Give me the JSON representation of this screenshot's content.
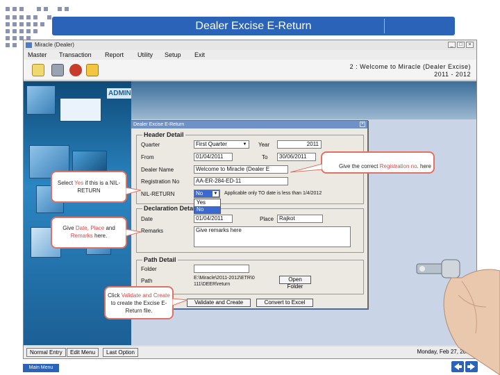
{
  "slide": {
    "title": "Dealer Excise E-Return",
    "main_menu_label": "Main Menu"
  },
  "window": {
    "title": "Miracle (Dealer)",
    "controls": [
      "_",
      "□",
      "×"
    ]
  },
  "menu": [
    "Master",
    "Transaction",
    "Report",
    "Utility",
    "Setup",
    "Exit"
  ],
  "welcome": {
    "line1": "2 : Welcome to Miracle (Dealer Excise)",
    "line2": "2011 - 2012"
  },
  "toolbar_icons": [
    "document-icon",
    "cart-icon",
    "money-bag-icon",
    "edit-icon"
  ],
  "left_pane": {
    "admin_text": "ADMIN"
  },
  "dialog": {
    "title": "Dealer Excise E-Return",
    "close": "×",
    "header_detail": {
      "title": "Header Detail",
      "quarter_label": "Quarter",
      "quarter_value": "First Quarter",
      "year_label": "Year",
      "year_value": "2011",
      "from_label": "From",
      "from_value": "01/04/2011",
      "to_label": "To",
      "to_value": "30/06/2011",
      "dealer_name_label": "Dealer Name",
      "dealer_name_value": "Welcome to Miracle (Dealer E",
      "reg_no_label": "Registration No",
      "reg_no_value": "AA-ER-284-ED-11",
      "nil_return_label": "NIL-RETURN",
      "nil_return_value": "No",
      "nil_return_note": "Applicable only TO date is less than 1/4/2012",
      "nil_return_options": [
        "Yes",
        "No"
      ]
    },
    "declaration_detail": {
      "title": "Declaration Detail",
      "date_label": "Date",
      "date_value": "01/04/2011",
      "place_label": "Place",
      "place_value": "Rajkot",
      "remarks_label": "Remarks",
      "remarks_value": "Give remarks here"
    },
    "path_detail": {
      "title": "Path Detail",
      "folder_label": "Folder",
      "folder_value": "",
      "path_label": "Path",
      "path_value_line1": "E:\\Miracle\\2011-2012\\ETR\\0",
      "path_value_line2": "111\\DEER\\return",
      "open_folder": "Open Folder"
    },
    "validate_button": "Validate and Create",
    "convert_button": "Convert to Excel"
  },
  "status_bar": {
    "buttons": [
      "Normal Entry",
      "Edit Menu",
      "Last Option"
    ],
    "date": "Monday, Feb 27, 2012"
  },
  "callouts": {
    "registration_pre": "Give the correct ",
    "registration_hl": "Registration no.",
    "registration_post": " here",
    "nil_pre": "Select ",
    "nil_hl": "Yes",
    "nil_post": " if this is a NIL-RETURN",
    "remarks_pre": "Give ",
    "remarks_hl1": "Date, Place",
    "remarks_mid": " and ",
    "remarks_hl2": "Remarks",
    "remarks_post": " here.",
    "validate_pre": "Click ",
    "validate_hl": "Validate and Create",
    "validate_post": " to create the Excise E-Return file."
  },
  "colors": {
    "banner": "#2a63b8",
    "callout_border": "#e07060",
    "highlight": "#d84a4a"
  }
}
